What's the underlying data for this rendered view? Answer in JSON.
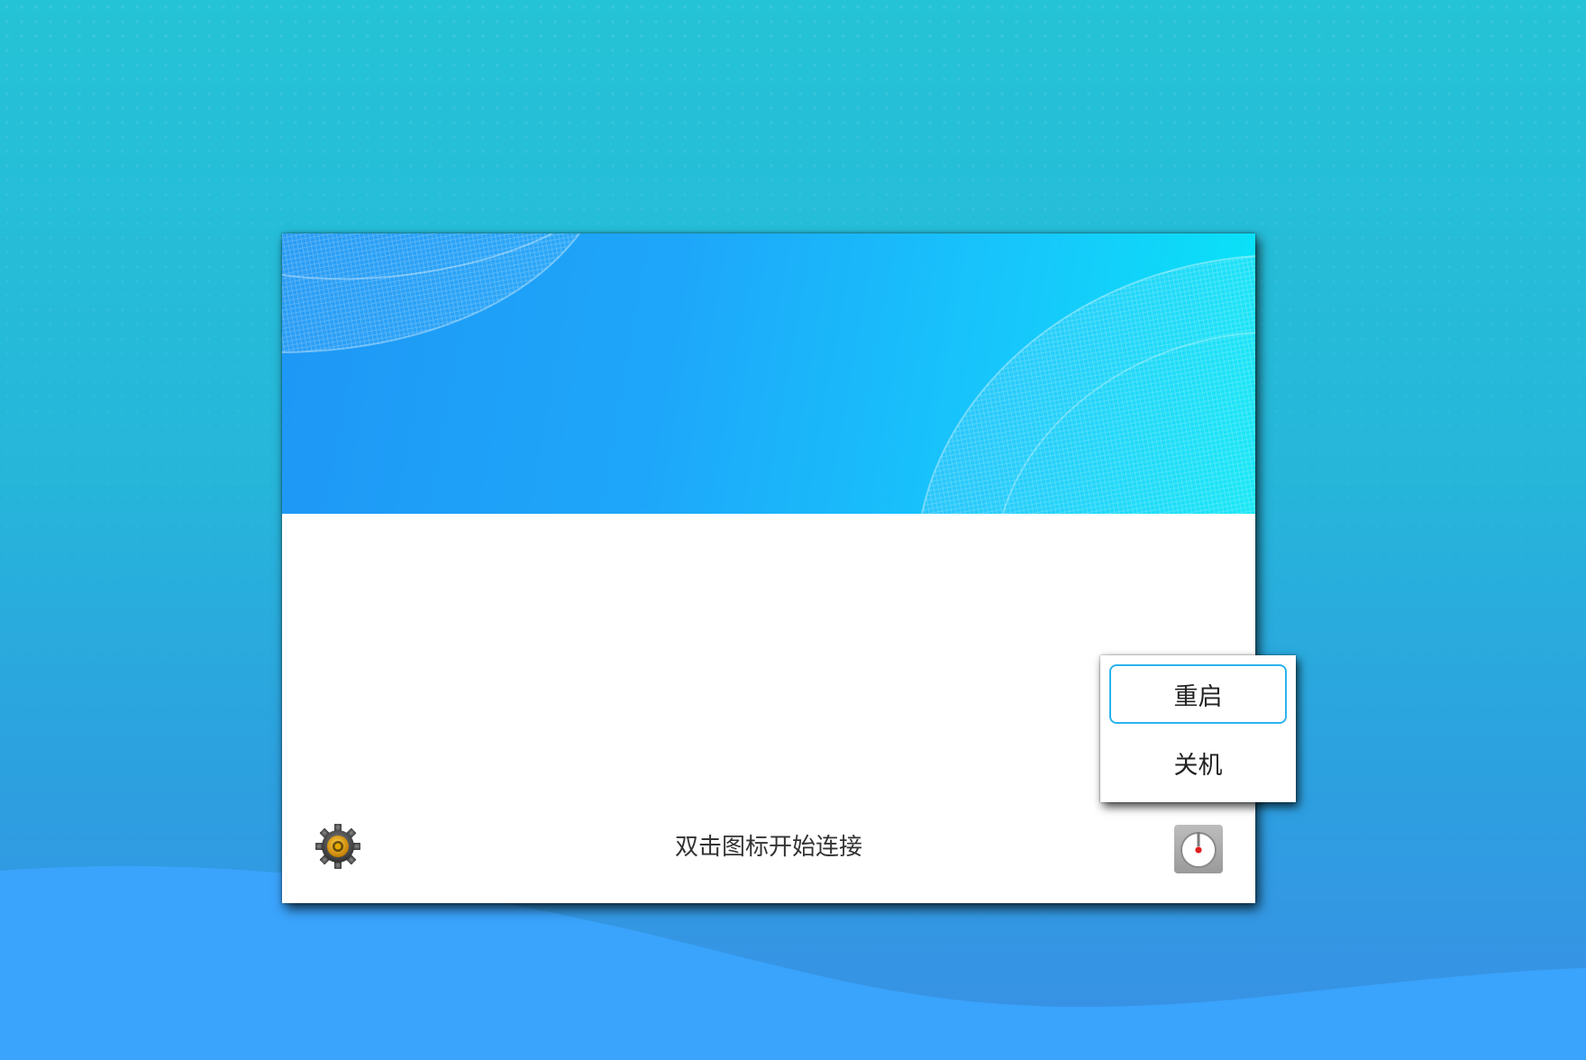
{
  "dialog": {
    "hint_text": "双击图标开始连接"
  },
  "power_menu": {
    "items": [
      {
        "label": "重启",
        "selected": true
      },
      {
        "label": "关机",
        "selected": false
      }
    ]
  },
  "icons": {
    "settings": "gear-icon",
    "power": "power-icon"
  },
  "colors": {
    "desktop_top": "#25c3d6",
    "desktop_bottom": "#3a8fe6",
    "banner_left": "#1e97f5",
    "banner_right": "#07e6f6",
    "menu_highlight": "#2bb3ee"
  }
}
